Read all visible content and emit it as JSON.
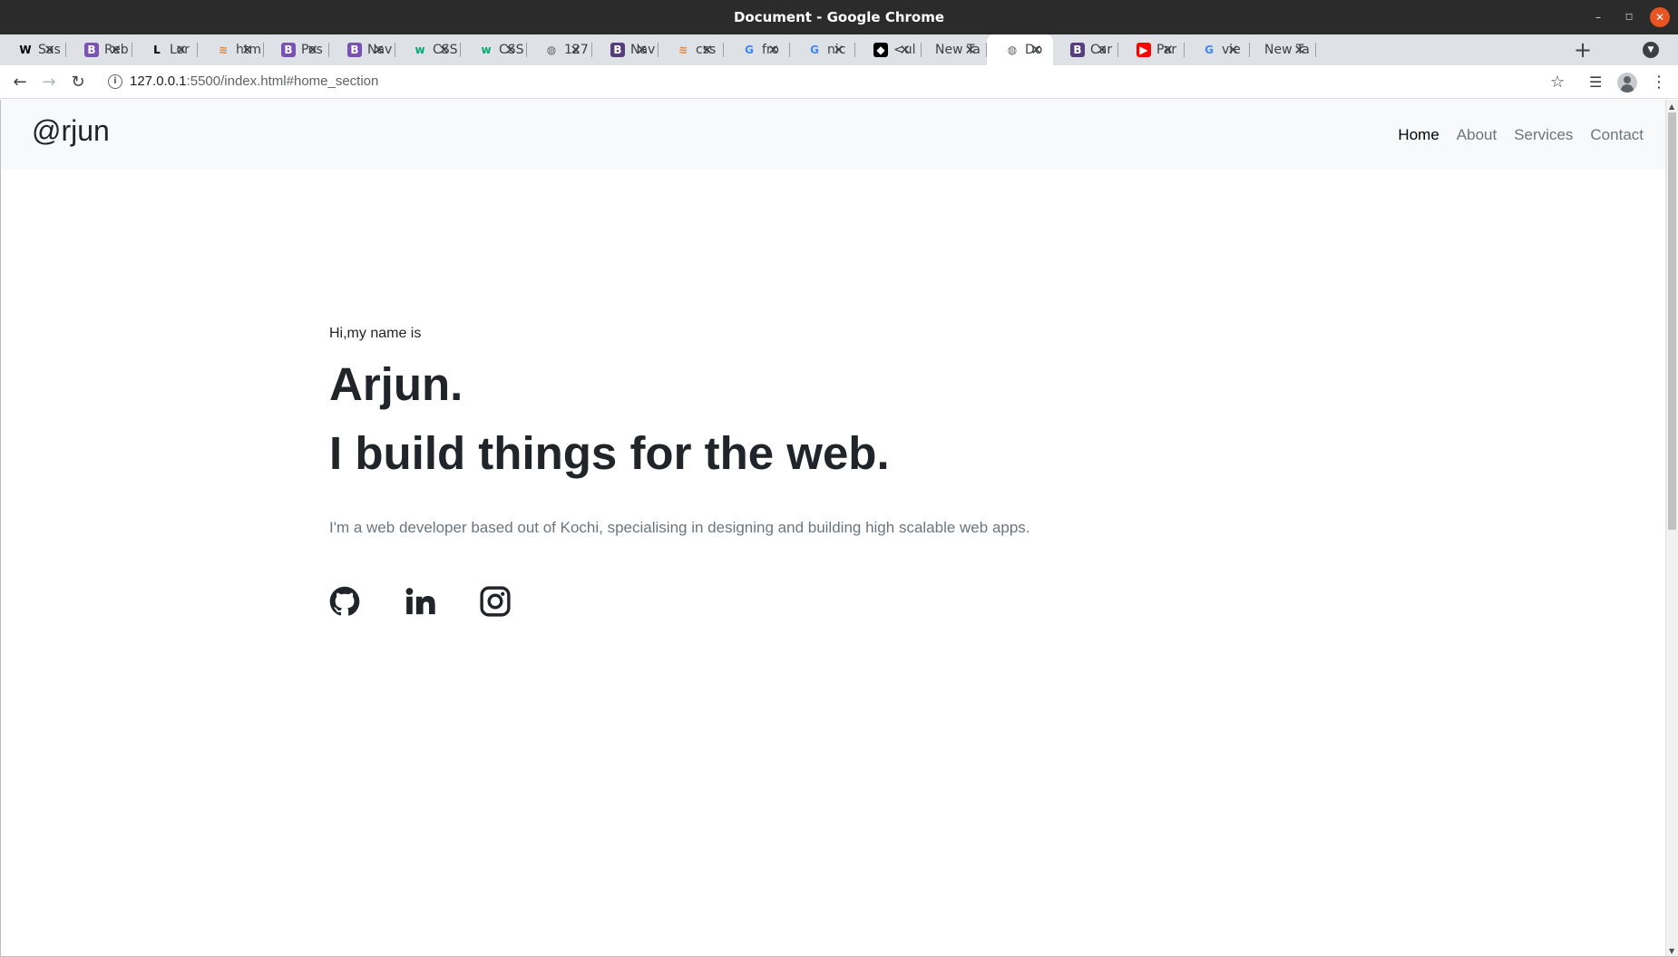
{
  "window": {
    "title": "Document - Google Chrome",
    "controls": {
      "minimize": "–",
      "maximize": "◻",
      "close": "✕"
    }
  },
  "tabs": [
    {
      "favicon": "wikipedia-icon",
      "fav_glyph": "W",
      "fav_color": "#000000",
      "fav_bg": "transparent",
      "title": "Sas"
    },
    {
      "favicon": "bootstrap-icon",
      "fav_glyph": "B",
      "fav_color": "#ffffff",
      "fav_bg": "#7952b3",
      "title": "Reb"
    },
    {
      "favicon": "lorem-icon",
      "fav_glyph": "L",
      "fav_color": "#000000",
      "fav_bg": "transparent",
      "title": "Lor"
    },
    {
      "favicon": "stackoverflow-icon",
      "fav_glyph": "≋",
      "fav_color": "#f48024",
      "fav_bg": "transparent",
      "title": "htm"
    },
    {
      "favicon": "bootstrap-icon",
      "fav_glyph": "B",
      "fav_color": "#ffffff",
      "fav_bg": "#7952b3",
      "title": "Pos"
    },
    {
      "favicon": "bootstrap-icon",
      "fav_glyph": "B",
      "fav_color": "#ffffff",
      "fav_bg": "#7952b3",
      "title": "Nav"
    },
    {
      "favicon": "w3schools-icon",
      "fav_glyph": "w",
      "fav_color": "#04aa6d",
      "fav_bg": "transparent",
      "title": "CSS"
    },
    {
      "favicon": "w3schools-icon",
      "fav_glyph": "w",
      "fav_color": "#04aa6d",
      "fav_bg": "transparent",
      "title": "CSS"
    },
    {
      "favicon": "globe-icon",
      "fav_glyph": "◍",
      "fav_color": "#5f6368",
      "fav_bg": "transparent",
      "title": "127"
    },
    {
      "favicon": "bootstrap-icon",
      "fav_glyph": "B",
      "fav_color": "#ffffff",
      "fav_bg": "#563d7c",
      "title": "Nav"
    },
    {
      "favicon": "stackoverflow-icon",
      "fav_glyph": "≋",
      "fav_color": "#f48024",
      "fav_bg": "transparent",
      "title": "css"
    },
    {
      "favicon": "google-icon",
      "fav_glyph": "G",
      "fav_color": "#4285f4",
      "fav_bg": "transparent",
      "title": "fro"
    },
    {
      "favicon": "google-icon",
      "fav_glyph": "G",
      "fav_color": "#4285f4",
      "fav_bg": "transparent",
      "title": "nic"
    },
    {
      "favicon": "codepen-icon",
      "fav_glyph": "◆",
      "fav_color": "#ffffff",
      "fav_bg": "#000000",
      "title": "<ul"
    },
    {
      "favicon": "",
      "fav_glyph": "",
      "fav_color": "#000000",
      "fav_bg": "transparent",
      "title": "New Ta"
    },
    {
      "favicon": "globe-icon",
      "fav_glyph": "◍",
      "fav_color": "#5f6368",
      "fav_bg": "transparent",
      "title": "Do",
      "active": true
    },
    {
      "favicon": "bootstrap-icon",
      "fav_glyph": "B",
      "fav_color": "#ffffff",
      "fav_bg": "#563d7c",
      "title": "Car"
    },
    {
      "favicon": "youtube-icon",
      "fav_glyph": "▶",
      "fav_color": "#ffffff",
      "fav_bg": "#ff0000",
      "title": "Par"
    },
    {
      "favicon": "google-icon",
      "fav_glyph": "G",
      "fav_color": "#4285f4",
      "fav_bg": "transparent",
      "title": "vie"
    },
    {
      "favicon": "",
      "fav_glyph": "",
      "fav_color": "#000000",
      "fav_bg": "transparent",
      "title": "New Ta"
    }
  ],
  "tab_close_glyph": "✕",
  "tabstrip": {
    "new_tab_glyph": "+",
    "search_tabs_glyph": "▼"
  },
  "toolbar": {
    "back_glyph": "←",
    "forward_glyph": "→",
    "reload_glyph": "↻",
    "url_host": "127.0.0.1",
    "url_path": ":5500/index.html#home_section",
    "info_glyph": "i",
    "star_glyph": "☆",
    "media_glyph": "☰",
    "menu_glyph": "⋮"
  },
  "page": {
    "brand": "@rjun",
    "nav": [
      {
        "label": "Home",
        "active": true
      },
      {
        "label": "About"
      },
      {
        "label": "Services"
      },
      {
        "label": "Contact"
      }
    ],
    "greeting": "Hi,my name is",
    "name": "Arjun.",
    "tagline": "I build things for the web.",
    "description": "I'm a web developer based out of Kochi, specialising in designing and building high scalable web apps.",
    "socials": [
      "github-icon",
      "linkedin-icon",
      "instagram-icon"
    ]
  },
  "colors": {
    "titlebar": "#2b2b2b",
    "tabstrip": "#dee1e6",
    "navbar_bg": "#f8f9fa",
    "text_dark": "#212529",
    "text_muted": "#6c757d",
    "close_button": "#e95420"
  }
}
